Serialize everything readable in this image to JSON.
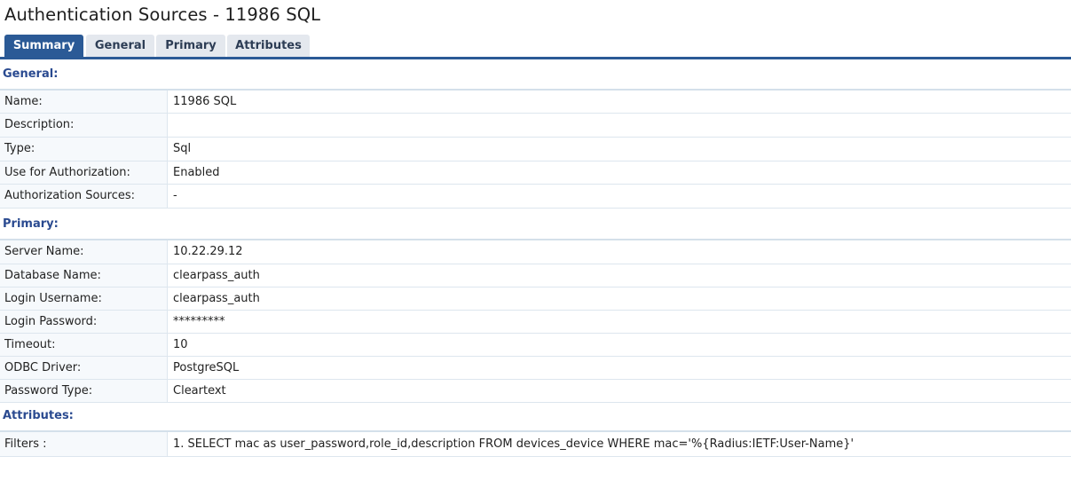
{
  "page": {
    "title": "Authentication Sources - 11986 SQL"
  },
  "tabs": [
    {
      "label": "Summary",
      "active": true
    },
    {
      "label": "General",
      "active": false
    },
    {
      "label": "Primary",
      "active": false
    },
    {
      "label": "Attributes",
      "active": false
    }
  ],
  "sections": {
    "general": {
      "title": "General:",
      "rows": [
        {
          "label": "Name:",
          "value": "11986 SQL"
        },
        {
          "label": "Description:",
          "value": ""
        },
        {
          "label": "Type:",
          "value": "Sql"
        },
        {
          "label": "Use for Authorization:",
          "value": "Enabled"
        },
        {
          "label": "Authorization Sources:",
          "value": "-"
        }
      ]
    },
    "primary": {
      "title": "Primary:",
      "rows": [
        {
          "label": "Server Name:",
          "value": "10.22.29.12"
        },
        {
          "label": "Database Name:",
          "value": "clearpass_auth"
        },
        {
          "label": "Login Username:",
          "value": "clearpass_auth"
        },
        {
          "label": "Login Password:",
          "value": "*********"
        },
        {
          "label": "Timeout:",
          "value": "10"
        },
        {
          "label": "ODBC Driver:",
          "value": "PostgreSQL"
        },
        {
          "label": "Password Type:",
          "value": "Cleartext"
        }
      ]
    },
    "attributes": {
      "title": "Attributes:",
      "rows": [
        {
          "label": "Filters :",
          "value": "1. SELECT mac as user_password,role_id,description FROM devices_device WHERE mac='%{Radius:IETF:User-Name}'"
        }
      ]
    }
  },
  "colors": {
    "accent": "#2b5a96",
    "section_title": "#2a4a90",
    "tab_inactive_bg": "#e4e8ee",
    "label_cell_bg": "#f6f9fc",
    "row_border": "#dde6ee"
  }
}
